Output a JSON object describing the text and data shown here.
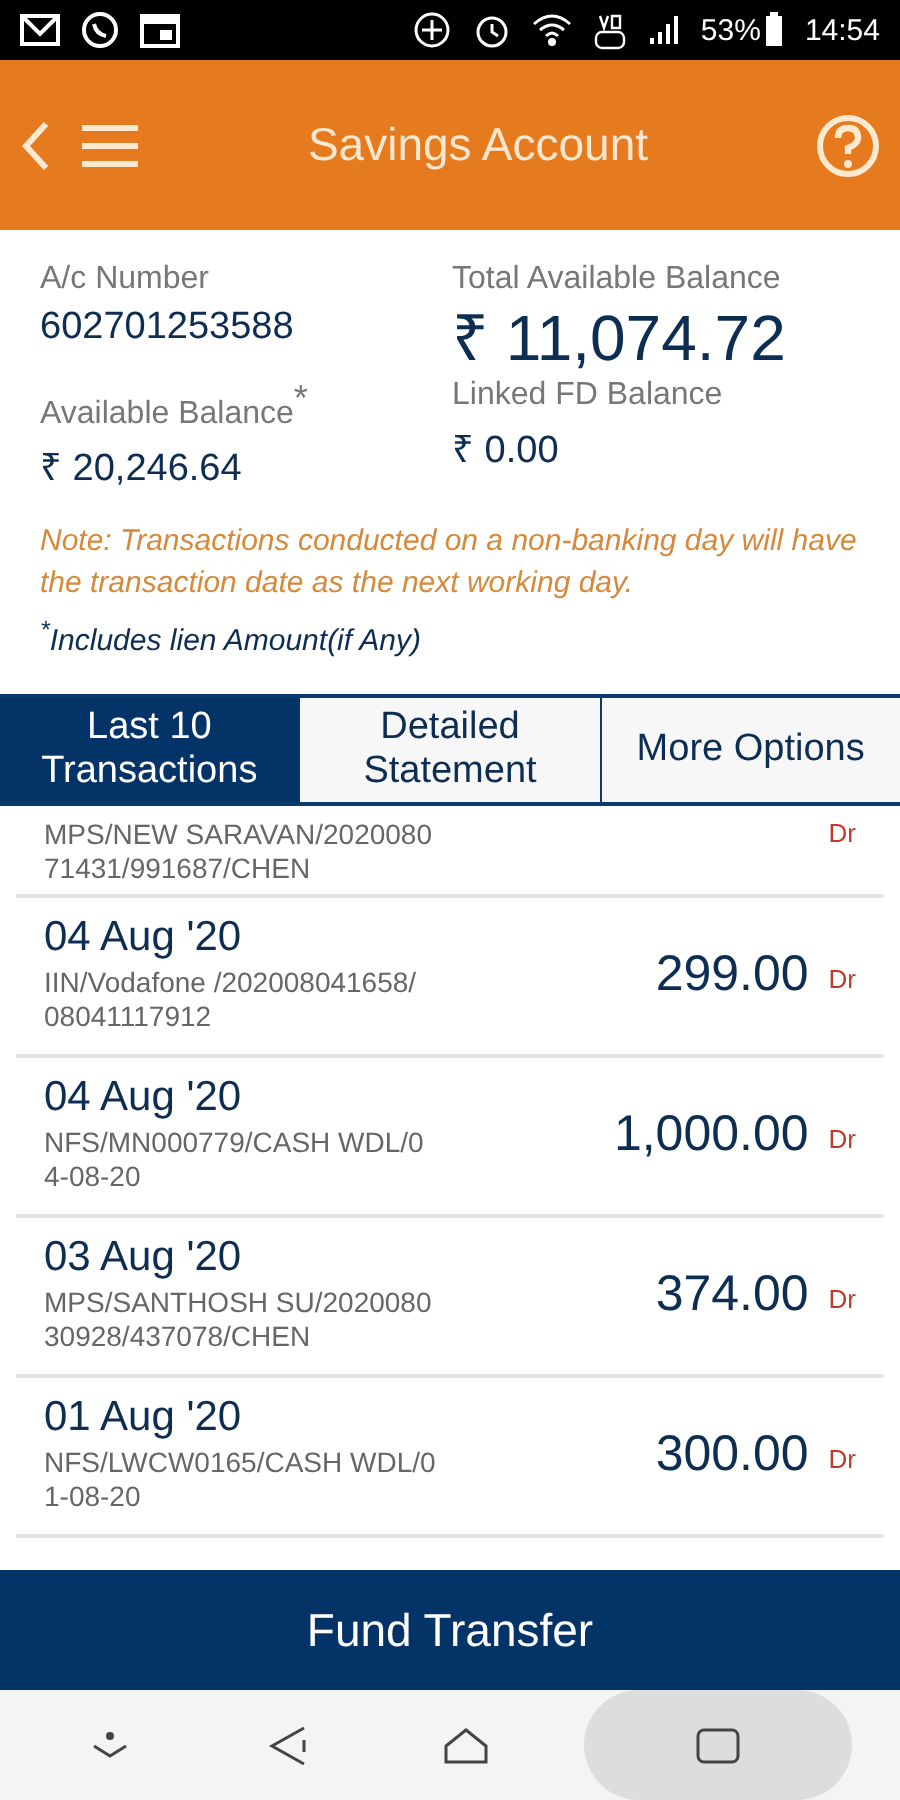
{
  "status_bar": {
    "battery": "53%",
    "time": "14:54"
  },
  "header": {
    "title": "Savings Account"
  },
  "account": {
    "number_label": "A/c Number",
    "number": "602701253588",
    "total_label": "Total Available Balance",
    "total": "₹ 11,074.72",
    "available_label": "Available Balance",
    "available_mark": "*",
    "available": "₹ 20,246.64",
    "fd_label": "Linked FD Balance",
    "fd": "₹ 0.00"
  },
  "note": "Note: Transactions conducted on a non-banking day will have the transaction date as the next working day.",
  "footnote": "$^{*}$Includes lien Amount(if Any)",
  "tabs": [
    {
      "label": "Last 10 Transactions",
      "selected": true
    },
    {
      "label": "Detailed Statement",
      "selected": false
    },
    {
      "label": "More Options",
      "selected": false
    }
  ],
  "transactions": [
    {
      "description_lines": [
        "MPS/NEW SARAVAN/2020080",
        "71431/991687/CHEN"
      ],
      "type": "Dr"
    },
    {
      "date": "04 Aug '20",
      "description_lines": [
        "IIN/Vodafone /202008041658/",
        "08041117912"
      ],
      "amount": "299.00",
      "type": "Dr"
    },
    {
      "date": "04 Aug '20",
      "description_lines": [
        "NFS/MN000779/CASH WDL/0",
        "4-08-20"
      ],
      "amount": "1,000.00",
      "type": "Dr"
    },
    {
      "date": "03 Aug '20",
      "description_lines": [
        "MPS/SANTHOSH SU/2020080",
        "30928/437078/CHEN"
      ],
      "amount": "374.00",
      "type": "Dr"
    },
    {
      "date": "01 Aug '20",
      "description_lines": [
        "NFS/LWCW0165/CASH WDL/0",
        "1-08-20"
      ],
      "amount": "300.00",
      "type": "Dr"
    }
  ],
  "action_button": "Fund Transfer"
}
